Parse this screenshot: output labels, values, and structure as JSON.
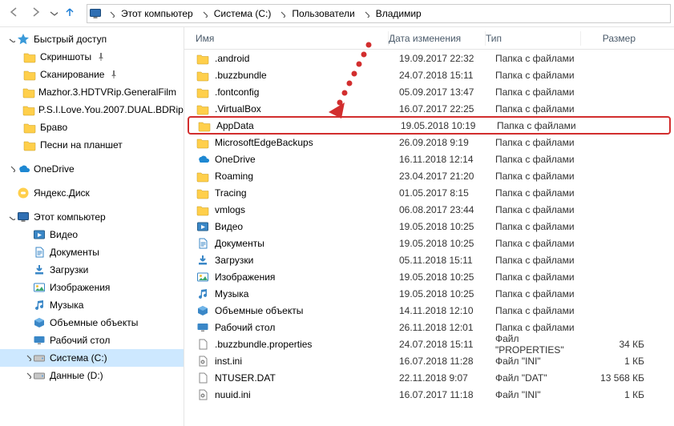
{
  "breadcrumbs": {
    "segments": [
      "Этот компьютер",
      "Система (C:)",
      "Пользователи",
      "Владимир"
    ]
  },
  "sidebar": {
    "quick_access": {
      "label": "Быстрый доступ"
    },
    "qa_items": [
      {
        "label": "Скриншоты",
        "pin": true,
        "icon": "folder"
      },
      {
        "label": "Сканирование",
        "pin": true,
        "icon": "folder"
      },
      {
        "label": "Mazhor.3.HDTVRip.GeneralFilm",
        "pin": true,
        "icon": "folder"
      },
      {
        "label": "P.S.I.Love.You.2007.DUAL.BDRip",
        "pin": true,
        "icon": "folder"
      },
      {
        "label": "Браво",
        "pin": false,
        "icon": "folder"
      },
      {
        "label": "Песни на планшет",
        "pin": false,
        "icon": "folder"
      }
    ],
    "onedrive": {
      "label": "OneDrive"
    },
    "yadisk": {
      "label": "Яндекс.Диск"
    },
    "this_pc": {
      "label": "Этот компьютер"
    },
    "pc_items": [
      {
        "label": "Видео",
        "icon": "videos"
      },
      {
        "label": "Документы",
        "icon": "documents"
      },
      {
        "label": "Загрузки",
        "icon": "downloads"
      },
      {
        "label": "Изображения",
        "icon": "pictures"
      },
      {
        "label": "Музыка",
        "icon": "music"
      },
      {
        "label": "Объемные объекты",
        "icon": "objects3d"
      },
      {
        "label": "Рабочий стол",
        "icon": "desktop"
      },
      {
        "label": "Система (C:)",
        "icon": "drive",
        "selected": true
      },
      {
        "label": "Данные (D:)",
        "icon": "drive"
      }
    ]
  },
  "columns": {
    "name": "Имя",
    "date": "Дата изменения",
    "type": "Тип",
    "size": "Размер"
  },
  "type_labels": {
    "folder": "Папка с файлами",
    "properties": "Файл \"PROPERTIES\"",
    "ini": "Файл \"INI\"",
    "dat": "Файл \"DAT\""
  },
  "files": [
    {
      "name": ".android",
      "date": "19.09.2017 22:32",
      "type": "folder",
      "icon": "folder"
    },
    {
      "name": ".buzzbundle",
      "date": "24.07.2018 15:11",
      "type": "folder",
      "icon": "folder"
    },
    {
      "name": ".fontconfig",
      "date": "05.09.2017 13:47",
      "type": "folder",
      "icon": "folder"
    },
    {
      "name": ".VirtualBox",
      "date": "16.07.2017 22:25",
      "type": "folder",
      "icon": "folder"
    },
    {
      "name": "AppData",
      "date": "19.05.2018 10:19",
      "type": "folder",
      "icon": "folder",
      "highlight": true
    },
    {
      "name": "MicrosoftEdgeBackups",
      "date": "26.09.2018 9:19",
      "type": "folder",
      "icon": "folder"
    },
    {
      "name": "OneDrive",
      "date": "16.11.2018 12:14",
      "type": "folder",
      "icon": "onedrive"
    },
    {
      "name": "Roaming",
      "date": "23.04.2017 21:20",
      "type": "folder",
      "icon": "folder"
    },
    {
      "name": "Tracing",
      "date": "01.05.2017 8:15",
      "type": "folder",
      "icon": "folder"
    },
    {
      "name": "vmlogs",
      "date": "06.08.2017 23:44",
      "type": "folder",
      "icon": "folder"
    },
    {
      "name": "Видео",
      "date": "19.05.2018 10:25",
      "type": "folder",
      "icon": "videos"
    },
    {
      "name": "Документы",
      "date": "19.05.2018 10:25",
      "type": "folder",
      "icon": "documents"
    },
    {
      "name": "Загрузки",
      "date": "05.11.2018 15:11",
      "type": "folder",
      "icon": "downloads"
    },
    {
      "name": "Изображения",
      "date": "19.05.2018 10:25",
      "type": "folder",
      "icon": "pictures"
    },
    {
      "name": "Музыка",
      "date": "19.05.2018 10:25",
      "type": "folder",
      "icon": "music"
    },
    {
      "name": "Объемные объекты",
      "date": "14.11.2018 12:10",
      "type": "folder",
      "icon": "objects3d"
    },
    {
      "name": "Рабочий стол",
      "date": "26.11.2018 12:01",
      "type": "folder",
      "icon": "desktop"
    },
    {
      "name": ".buzzbundle.properties",
      "date": "24.07.2018 15:11",
      "type": "properties",
      "icon": "file",
      "size": "34 КБ"
    },
    {
      "name": "inst.ini",
      "date": "16.07.2018 11:28",
      "type": "ini",
      "icon": "ini",
      "size": "1 КБ"
    },
    {
      "name": "NTUSER.DAT",
      "date": "22.11.2018 9:07",
      "type": "dat",
      "icon": "file",
      "size": "13 568 КБ"
    },
    {
      "name": "nuuid.ini",
      "date": "16.07.2017 11:18",
      "type": "ini",
      "icon": "ini",
      "size": "1 КБ"
    }
  ]
}
